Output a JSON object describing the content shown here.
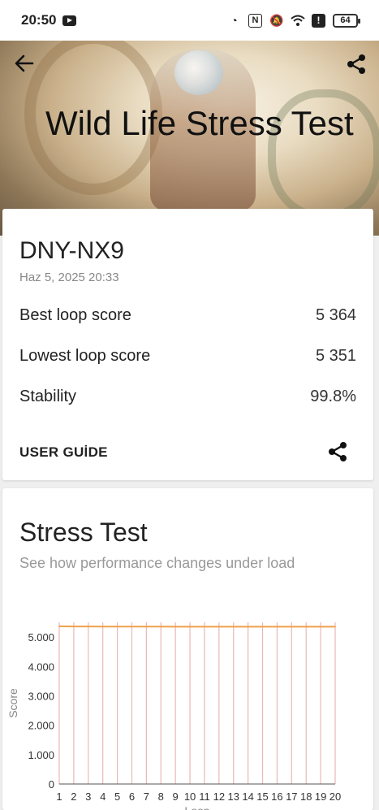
{
  "status_bar": {
    "time": "20:50",
    "battery": "64"
  },
  "header": {
    "title": "Wild Life Stress Test"
  },
  "result": {
    "device": "DNY-NX9",
    "date": "Haz 5, 2025 20:33",
    "rows": [
      {
        "label": "Best loop score",
        "value": "5 364"
      },
      {
        "label": "Lowest loop score",
        "value": "5 351"
      },
      {
        "label": "Stability",
        "value": "99.8%"
      }
    ],
    "guide_label": "USER GUİDE"
  },
  "stress": {
    "title": "Stress Test",
    "subtitle": "See how performance changes under load"
  },
  "chart_data": {
    "type": "line",
    "ylabel": "Score",
    "xlabel": "Loop",
    "ylim": [
      0,
      5500
    ],
    "yticks": [
      "0",
      "1.000",
      "2.000",
      "3.000",
      "4.000",
      "5.000"
    ],
    "ytick_values": [
      0,
      1000,
      2000,
      3000,
      4000,
      5000
    ],
    "x": [
      1,
      2,
      3,
      4,
      5,
      6,
      7,
      8,
      9,
      10,
      11,
      12,
      13,
      14,
      15,
      16,
      17,
      18,
      19,
      20
    ],
    "series": [
      {
        "values": [
          5364,
          5360,
          5358,
          5356,
          5355,
          5355,
          5354,
          5354,
          5353,
          5353,
          5353,
          5352,
          5352,
          5352,
          5352,
          5351,
          5351,
          5351,
          5351,
          5351
        ]
      }
    ],
    "line_color": "#f0a04b",
    "grid_color": "#e9b8b8"
  }
}
